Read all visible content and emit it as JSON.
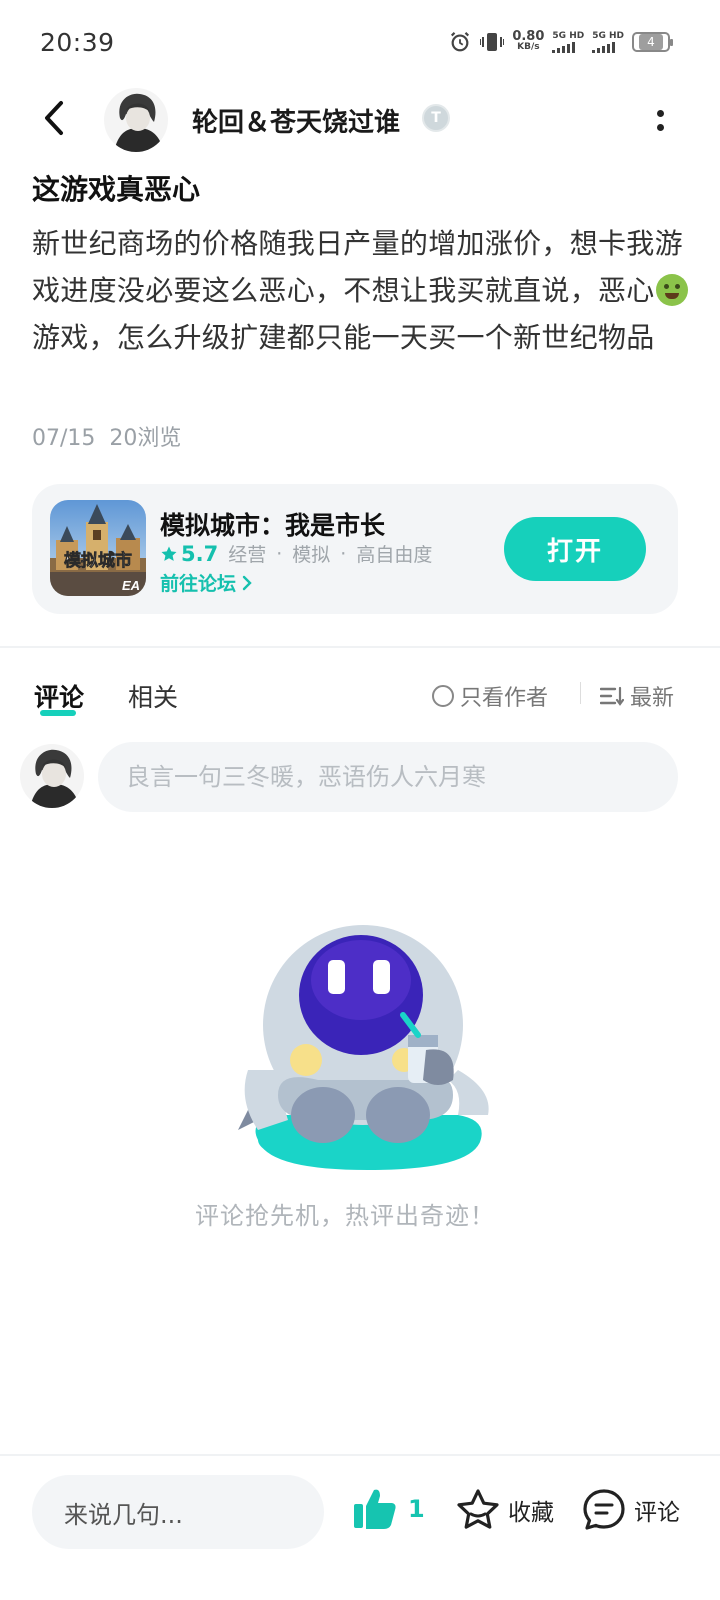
{
  "status_bar": {
    "time": "20:39",
    "net_speed": "0.80",
    "net_speed_unit": "KB/s",
    "sim1": "5G HD",
    "sim2": "5G HD",
    "battery": "4"
  },
  "header": {
    "username": "轮回＆苍天饶过谁",
    "badge_letter": "T"
  },
  "post": {
    "title": "这游戏真恶心",
    "body_part1": "新世纪商场的价格随我日产量的增加涨价，想卡我游戏进度没必要这么恶心，不想让我买就直说，恶心",
    "body_part2": "游戏，怎么升级扩建都只能一天买一个新世纪物品",
    "date": "07/15",
    "views": "20浏览"
  },
  "game": {
    "icon_text": "模拟城市",
    "icon_brand": "EA",
    "name": "模拟城市：我是市长",
    "rating": "5.7",
    "tags": [
      "经营",
      "模拟",
      "高自由度"
    ],
    "tag_separator": "·",
    "forum_link": "前往论坛",
    "open_label": "打开"
  },
  "tabs": {
    "comments": "评论",
    "related": "相关",
    "author_only": "只看作者",
    "sort": "最新"
  },
  "comment_box": {
    "placeholder": "良言一句三冬暖，恶语伤人六月寒"
  },
  "empty_state": {
    "text": "评论抢先机，热评出奇迹！"
  },
  "bottom_bar": {
    "say_placeholder": "来说几句...",
    "like_count": "1",
    "favorite_label": "收藏",
    "comment_label": "评论"
  },
  "colors": {
    "accent": "#16d0bb",
    "accent_text": "#15c0ae",
    "card_bg": "#f3f5f7"
  },
  "icons": [
    "alarm-icon",
    "vibrate-icon",
    "signal-icon",
    "battery-icon",
    "back-arrow-icon",
    "more-vertical-icon",
    "star-icon",
    "chevron-right-icon",
    "sort-icon",
    "thumbs-up-icon",
    "star-outline-icon",
    "comment-bubble-icon"
  ]
}
